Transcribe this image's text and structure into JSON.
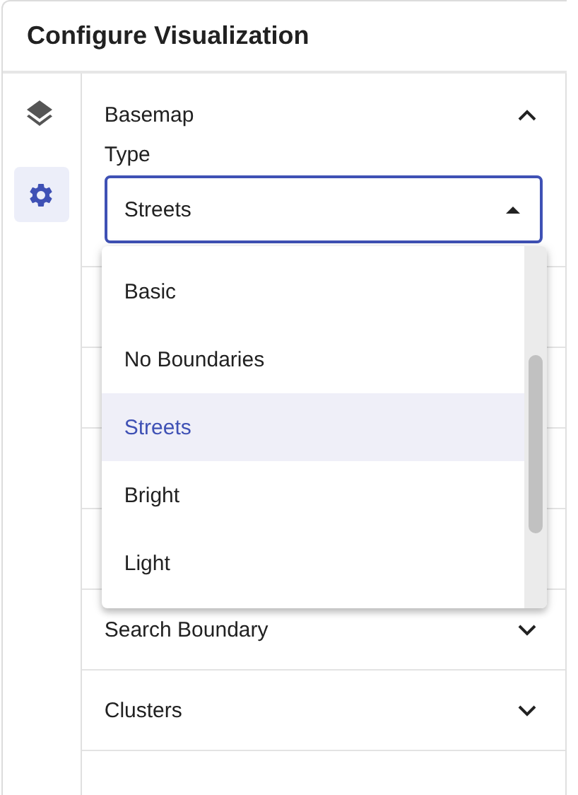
{
  "title": "Configure Visualization",
  "rail": [
    {
      "kind": "layers",
      "selected": false
    },
    {
      "kind": "settings",
      "selected": true
    }
  ],
  "sections": [
    {
      "title": "Basemap",
      "expanded": true,
      "field": {
        "label": "Type",
        "value": "Streets",
        "open": true,
        "options": [
          {
            "label": "Basic",
            "selected": false
          },
          {
            "label": "No Boundaries",
            "selected": false
          },
          {
            "label": "Streets",
            "selected": true
          },
          {
            "label": "Bright",
            "selected": false
          },
          {
            "label": "Light",
            "selected": false
          }
        ]
      }
    },
    {
      "title": "Search Boundary",
      "expanded": false
    },
    {
      "title": "Clusters",
      "expanded": false
    }
  ]
}
